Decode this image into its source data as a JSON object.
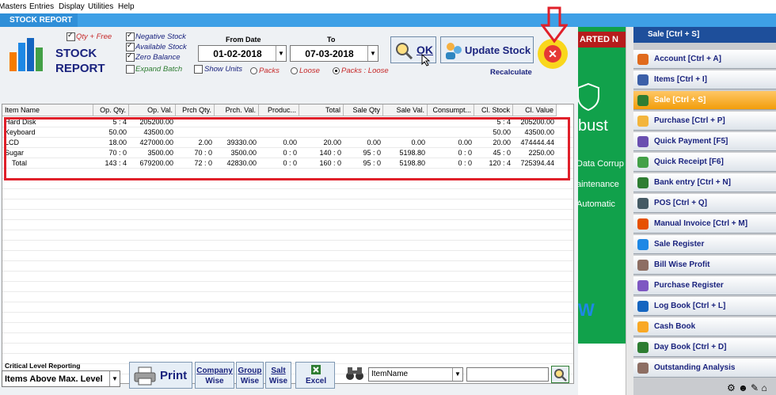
{
  "menu": [
    "Masters",
    "Entries",
    "Display",
    "Utilities",
    "Help"
  ],
  "tab": "STOCK REPORT",
  "header": {
    "title_line1": "STOCK",
    "title_line2": "REPORT"
  },
  "options": {
    "qty_free": "Qty + Free",
    "negative_stock": "Negative Stock",
    "available_stock": "Available Stock",
    "zero_balance": "Zero Balance",
    "expand_batch": "Expand Batch",
    "show_units": "Show Units",
    "packs": "Packs",
    "loose": "Loose",
    "packs_loose": "Packs : Loose"
  },
  "dates": {
    "from_label": "From Date",
    "to_label": "To",
    "from": "01-02-2018",
    "to": "07-03-2018"
  },
  "buttons": {
    "ok": "OK",
    "update_stock": "Update Stock",
    "recalculate": "Recalculate",
    "print": "Print",
    "company_wise_1": "Company",
    "company_wise_2": "Wise",
    "group_wise_1": "Group",
    "group_wise_2": "Wise",
    "salt_wise_1": "Salt",
    "salt_wise_2": "Wise",
    "excel": "Excel"
  },
  "grid": {
    "columns": [
      "Item Name",
      "Op. Qty.",
      "Op. Val.",
      "Prch Qty.",
      "Prch. Val.",
      "Produc...",
      "Total",
      "Sale Qty",
      "Sale Val.",
      "Consumpt...",
      "Cl. Stock",
      "Cl. Value"
    ],
    "rows": [
      [
        "Hard Disk",
        "5 : 4",
        "205200.00",
        "",
        "",
        "",
        "",
        "",
        "",
        "",
        "5 : 4",
        "205200.00"
      ],
      [
        "Keyboard",
        "50.00",
        "43500.00",
        "",
        "",
        "",
        "",
        "",
        "",
        "",
        "50.00",
        "43500.00"
      ],
      [
        "LCD",
        "18.00",
        "427000.00",
        "2.00",
        "39330.00",
        "0.00",
        "20.00",
        "0.00",
        "0.00",
        "0.00",
        "20.00",
        "474444.44"
      ],
      [
        "Sugar",
        "70 : 0",
        "3500.00",
        "70 : 0",
        "3500.00",
        "0 : 0",
        "140 : 0",
        "95 : 0",
        "5198.80",
        "0 : 0",
        "45 : 0",
        "2250.00"
      ],
      [
        "Total",
        "143 : 4",
        "679200.00",
        "72 : 0",
        "42830.00",
        "0 : 0",
        "160 : 0",
        "95 : 0",
        "5198.80",
        "0 : 0",
        "120 : 4",
        "725394.44"
      ]
    ]
  },
  "bottom": {
    "critical_label": "Critical Level Reporting",
    "critical_value": "Items Above Max. Level",
    "search_field": "ItemName",
    "search_value": ""
  },
  "splash": {
    "banner": "ARTED N",
    "line1": "bust",
    "line2": "Data Corrup",
    "line3": "aintenance",
    "line4": "Automatic",
    "line5": "W"
  },
  "nav": {
    "header": "Sale [Ctrl + S]",
    "items": [
      {
        "label": "Account [Ctrl + A]",
        "color": "#e06a1c"
      },
      {
        "label": "Items [Ctrl + I]",
        "color": "#3b5fa8"
      },
      {
        "label": "Sale [Ctrl + S]",
        "color": "#2e7d32"
      },
      {
        "label": "Purchase [Ctrl + P]",
        "color": "#f3b53c"
      },
      {
        "label": "Quick Payment [F5]",
        "color": "#6a4fb0"
      },
      {
        "label": "Quick Receipt [F6]",
        "color": "#43a047"
      },
      {
        "label": "Bank entry [Ctrl + N]",
        "color": "#2e7d32"
      },
      {
        "label": "POS [Ctrl + Q]",
        "color": "#455a64"
      },
      {
        "label": "Manual Invoice [Ctrl + M]",
        "color": "#e65100"
      },
      {
        "label": "Sale Register",
        "color": "#1e88e5"
      },
      {
        "label": "Bill Wise Profit",
        "color": "#8d6e63"
      },
      {
        "label": "Purchase Register",
        "color": "#7e57c2"
      },
      {
        "label": "Log Book [Ctrl + L]",
        "color": "#1565c0"
      },
      {
        "label": "Cash Book",
        "color": "#f9a825"
      },
      {
        "label": "Day Book [Ctrl + D]",
        "color": "#2e7d32"
      },
      {
        "label": "Outstanding Analysis",
        "color": "#8d6e63"
      }
    ],
    "active_index": 2
  }
}
